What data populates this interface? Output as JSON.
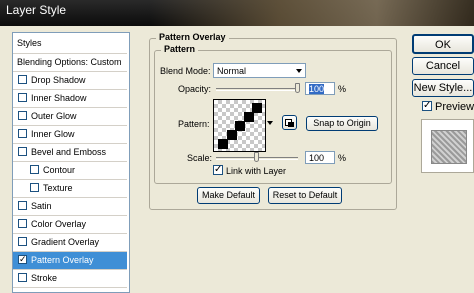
{
  "window": {
    "title": "Layer Style"
  },
  "sidebar": {
    "header": "Styles",
    "items": [
      {
        "label": "Blending Options: Custom",
        "checkbox": false,
        "checked": false,
        "indent": false,
        "selected": false
      },
      {
        "label": "Drop Shadow",
        "checkbox": true,
        "checked": false,
        "indent": false,
        "selected": false
      },
      {
        "label": "Inner Shadow",
        "checkbox": true,
        "checked": false,
        "indent": false,
        "selected": false
      },
      {
        "label": "Outer Glow",
        "checkbox": true,
        "checked": false,
        "indent": false,
        "selected": false
      },
      {
        "label": "Inner Glow",
        "checkbox": true,
        "checked": false,
        "indent": false,
        "selected": false
      },
      {
        "label": "Bevel and Emboss",
        "checkbox": true,
        "checked": false,
        "indent": false,
        "selected": false
      },
      {
        "label": "Contour",
        "checkbox": true,
        "checked": false,
        "indent": true,
        "selected": false
      },
      {
        "label": "Texture",
        "checkbox": true,
        "checked": false,
        "indent": true,
        "selected": false
      },
      {
        "label": "Satin",
        "checkbox": true,
        "checked": false,
        "indent": false,
        "selected": false
      },
      {
        "label": "Color Overlay",
        "checkbox": true,
        "checked": false,
        "indent": false,
        "selected": false
      },
      {
        "label": "Gradient Overlay",
        "checkbox": true,
        "checked": false,
        "indent": false,
        "selected": false
      },
      {
        "label": "Pattern Overlay",
        "checkbox": true,
        "checked": true,
        "indent": false,
        "selected": true
      },
      {
        "label": "Stroke",
        "checkbox": true,
        "checked": false,
        "indent": false,
        "selected": false
      }
    ]
  },
  "panel": {
    "outer_title": "Pattern Overlay",
    "inner_title": "Pattern",
    "blend_mode": {
      "label": "Blend Mode:",
      "value": "Normal"
    },
    "opacity": {
      "label": "Opacity:",
      "value": "100",
      "unit": "%",
      "level": 1.0
    },
    "pattern": {
      "label": "Pattern:",
      "snap_label": "Snap to Origin"
    },
    "scale": {
      "label": "Scale:",
      "value": "100",
      "unit": "%",
      "level": 0.22
    },
    "link": {
      "label": "Link with Layer",
      "checked": true
    },
    "make_default": "Make Default",
    "reset_default": "Reset to Default"
  },
  "actions": {
    "ok": "OK",
    "cancel": "Cancel",
    "new_style": "New Style...",
    "preview": {
      "label": "Preview",
      "checked": true
    }
  },
  "colors": {
    "accent": "#3f8fd6",
    "titlebar": "#111111",
    "dialog_bg": "#ece9d8"
  }
}
